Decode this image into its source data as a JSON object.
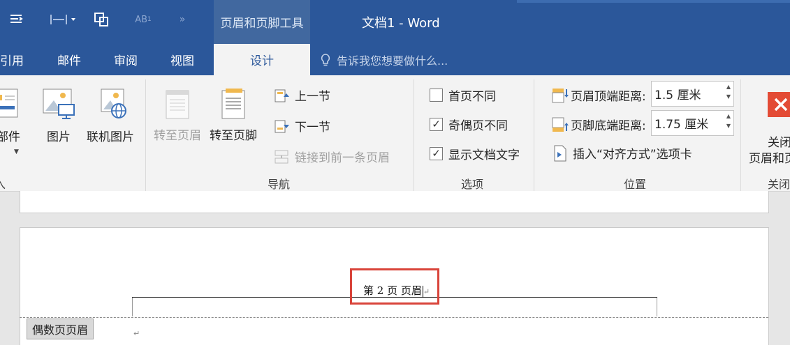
{
  "titlebar": {
    "context_group": "页眉和页脚工具",
    "doc_title": "文档1 - Word",
    "quick_access": [
      "paragraph-icon",
      "spacing-icon",
      "frame-icon",
      "superscript-icon",
      "more-icon"
    ]
  },
  "tabs": {
    "items": [
      "引用",
      "邮件",
      "审阅",
      "视图"
    ],
    "active": "设计",
    "tellme": "告诉我您想要做什么..."
  },
  "ribbon": {
    "insert_group": {
      "docparts": "档部件",
      "picture": "图片",
      "online_picture": "联机图片",
      "label": "入"
    },
    "nav_group": {
      "goto_header": "转至页眉",
      "goto_footer": "转至页脚",
      "prev": "上一节",
      "next": "下一节",
      "link_prev": "链接到前一条页眉",
      "label": "导航"
    },
    "options_group": {
      "first_page": {
        "label": "首页不同",
        "checked": false
      },
      "odd_even": {
        "label": "奇偶页不同",
        "checked": true
      },
      "show_text": {
        "label": "显示文档文字",
        "checked": true
      },
      "label": "选项"
    },
    "position_group": {
      "header_top_label": "页眉顶端距离:",
      "header_top_value": "1.5 厘米",
      "footer_bottom_label": "页脚底端距离:",
      "footer_bottom_value": "1.75 厘米",
      "insert_align_tab": "插入“对齐方式”选项卡",
      "label": "位置"
    },
    "close_group": {
      "close_line1": "关闭",
      "close_line2": "页眉和页",
      "label": "关闭"
    }
  },
  "document": {
    "header_text": "第 2 页  页眉",
    "even_header_label": "偶数页页眉"
  },
  "colors": {
    "accent": "#2b579a",
    "ribbon_bg": "#f3f3f3",
    "highlight": "#d9443a",
    "close_red": "#e34b35"
  }
}
